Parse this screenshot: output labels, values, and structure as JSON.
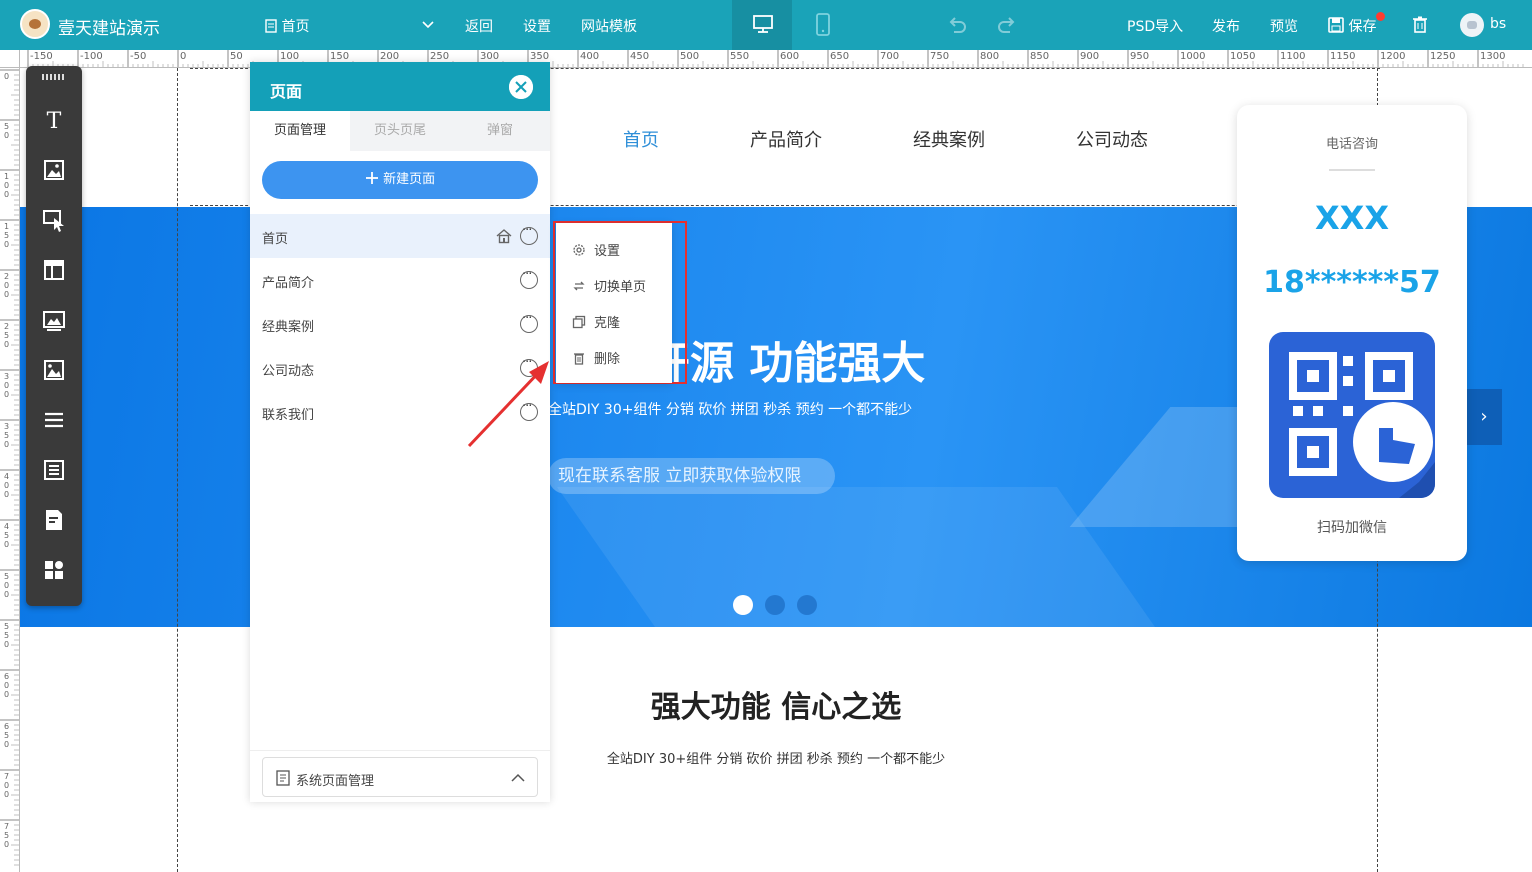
{
  "topbar": {
    "brand": "壹天建站演示",
    "page_select": "首页",
    "back": "返回",
    "settings": "设置",
    "templates": "网站模板",
    "psd_import": "PSD导入",
    "publish": "发布",
    "preview": "预览",
    "save": "保存",
    "user": "bs"
  },
  "ruler": {
    "top_labels": [
      "-150",
      "-100",
      "-50",
      "0",
      "50",
      "100",
      "150",
      "200",
      "250",
      "300",
      "350",
      "400",
      "450",
      "500",
      "550",
      "600",
      "650",
      "700",
      "750",
      "800",
      "850",
      "900",
      "950",
      "1000",
      "1050",
      "1100",
      "1150",
      "1200",
      "1250",
      "1300"
    ],
    "left_labels": [
      "0",
      "50",
      "100",
      "150",
      "200",
      "250",
      "300",
      "350",
      "400",
      "450",
      "500",
      "550",
      "600",
      "650",
      "700",
      "750"
    ]
  },
  "site": {
    "nav": [
      "首页",
      "产品简介",
      "经典案例",
      "公司动态"
    ],
    "banner_headline": "开源  功能强大",
    "banner_sub": "全站DIY 30+组件 分销 砍价 拼团 秒杀 预约 一个都不能少",
    "banner_cta": "现在联系客服  立即获取体验权限",
    "section_title": "强大功能 信心之选",
    "section_sub": "全站DIY 30+组件 分销 砍价 拼团 秒杀 预约 一个都不能少"
  },
  "contact": {
    "label": "电话咨询",
    "name": "XXX",
    "phone": "18******57",
    "qr_label": "扫码加微信"
  },
  "panel": {
    "title": "页面",
    "tabs": [
      "页面管理",
      "页头页尾",
      "弹窗"
    ],
    "new_page": "新建页面",
    "pages": [
      "首页",
      "产品简介",
      "经典案例",
      "公司动态",
      "联系我们"
    ],
    "system_pages": "系统页面管理"
  },
  "context_menu": {
    "items": [
      "设置",
      "切换单页",
      "克隆",
      "删除"
    ]
  },
  "colors": {
    "topbar": "#1aa3b8",
    "accent": "#3d94f0",
    "highlight_border": "#e53030"
  }
}
